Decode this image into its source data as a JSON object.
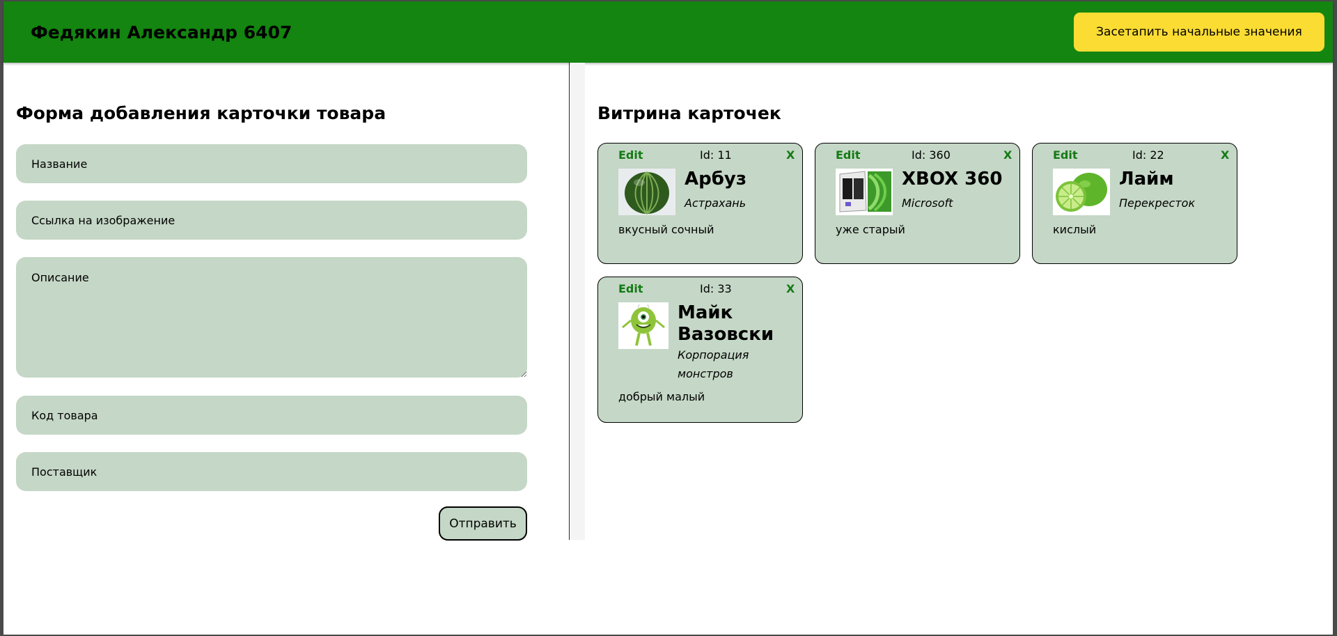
{
  "header": {
    "title": "Федякин Александр 6407",
    "reset_label": "Засетапить начальные значения"
  },
  "form": {
    "title": "Форма добавления карточки товара",
    "name_placeholder": "Название",
    "image_placeholder": "Ссылка на изображение",
    "description_placeholder": "Описание",
    "code_placeholder": "Код товара",
    "supplier_placeholder": "Поставщик",
    "submit_label": "Отправить"
  },
  "showcase": {
    "title": "Витрина карточек",
    "cards": [
      {
        "edit_label": "Edit",
        "id_label": "Id: 11",
        "delete_label": "X",
        "name": "Арбуз",
        "vendor": "Астрахань",
        "description": "вкусный сочный",
        "image_icon": "watermelon-image"
      },
      {
        "edit_label": "Edit",
        "id_label": "Id: 360",
        "delete_label": "X",
        "name": "XBOX 360",
        "vendor": "Microsoft",
        "description": "уже старый",
        "image_icon": "xbox-image"
      },
      {
        "edit_label": "Edit",
        "id_label": "Id: 22",
        "delete_label": "X",
        "name": "Лайм",
        "vendor": "Перекресток",
        "description": "кислый",
        "image_icon": "lime-image"
      },
      {
        "edit_label": "Edit",
        "id_label": "Id: 33",
        "delete_label": "X",
        "name": "Майк Вазовски",
        "vendor": "Корпорация монстров",
        "description": "добрый малый",
        "image_icon": "mike-wazowski-image"
      }
    ]
  },
  "colors": {
    "header_bg": "#138510",
    "accent_yellow": "#fbdc33",
    "card_bg": "#c5d7c6",
    "link_green": "#137a14"
  }
}
